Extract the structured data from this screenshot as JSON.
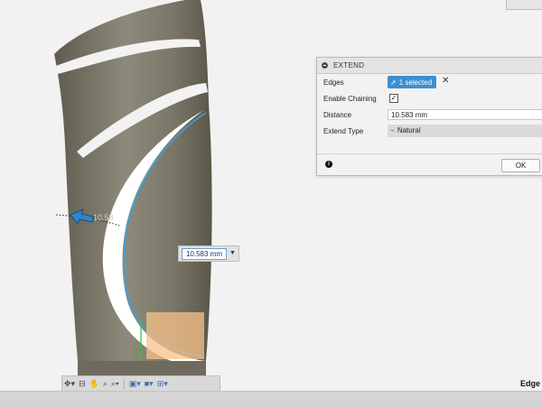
{
  "dialog": {
    "title": "EXTEND",
    "edges_label": "Edges",
    "edges_value": "1 selected",
    "chaining_label": "Enable Chaining",
    "chaining_checked": true,
    "distance_label": "Distance",
    "distance_value": "10.583 mm",
    "type_label": "Extend Type",
    "type_value": "Natural",
    "ok_label": "OK"
  },
  "viewport": {
    "dim_input_value": "10.583 mm",
    "dim_ghost_text": "10.58",
    "edge_label": "Edge"
  },
  "colors": {
    "selection": "#3d8fd1",
    "body_gray": "#74705f",
    "preview_orange": "#f5c28a",
    "edge_blue": "#3aa0e0"
  },
  "icons": [
    "cursor-icon",
    "close-icon",
    "checkbox-icon",
    "extend-type-icon",
    "info-icon",
    "orbit-icon",
    "pan-icon",
    "zoom-icon",
    "display-icon",
    "grid-icon"
  ]
}
